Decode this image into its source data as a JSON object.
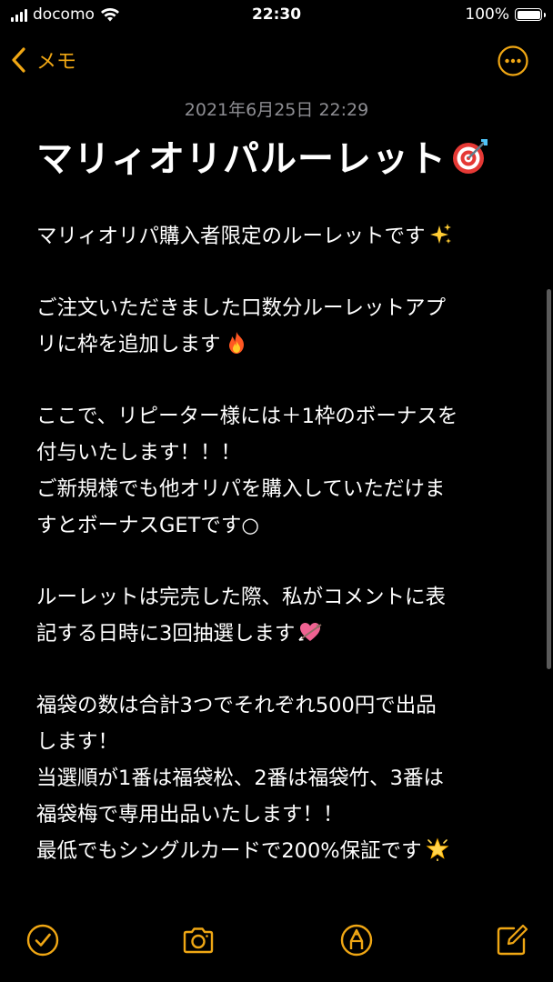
{
  "status_bar": {
    "carrier": "docomo",
    "time": "22:30",
    "battery_text": "100%",
    "battery_level": 1.0
  },
  "nav": {
    "back_label": "メモ",
    "accent_color": "#f0a714"
  },
  "note": {
    "date": "2021年6月25日 22:29",
    "title": "マリィオリパルーレット",
    "title_emoji": "direct-hit-icon",
    "paragraphs": [
      {
        "lines": [
          "マリィオリパ購入者限定のルーレットです"
        ],
        "emoji": "sparkles-icon"
      },
      {
        "lines": [
          "ご注文いただきました口数分ルーレットアプ",
          "リに枠を追加します"
        ],
        "emoji": "fire-icon"
      },
      {
        "lines": [
          "ここで、リピーター様には＋1枠のボーナスを",
          "付与いたします！！！",
          "ご新規様でも他オリパを購入していただけま",
          "すとボーナスGETです○"
        ]
      },
      {
        "lines": [
          "ルーレットは完売した際、私がコメントに表",
          "記する日時に3回抽選します"
        ],
        "emoji": "heart-with-arrow-icon"
      },
      {
        "lines": [
          "福袋の数は合計3つでそれぞれ500円で出品",
          "します！",
          "当選順が1番は福袋松、2番は福袋竹、3番は",
          "福袋梅で専用出品いたします！！",
          "最低でもシングルカードで200%保証です"
        ],
        "emoji": "glowing-star-icon"
      }
    ]
  },
  "toolbar": {
    "items": [
      "checklist-icon",
      "camera-icon",
      "markup-icon",
      "compose-icon"
    ]
  }
}
